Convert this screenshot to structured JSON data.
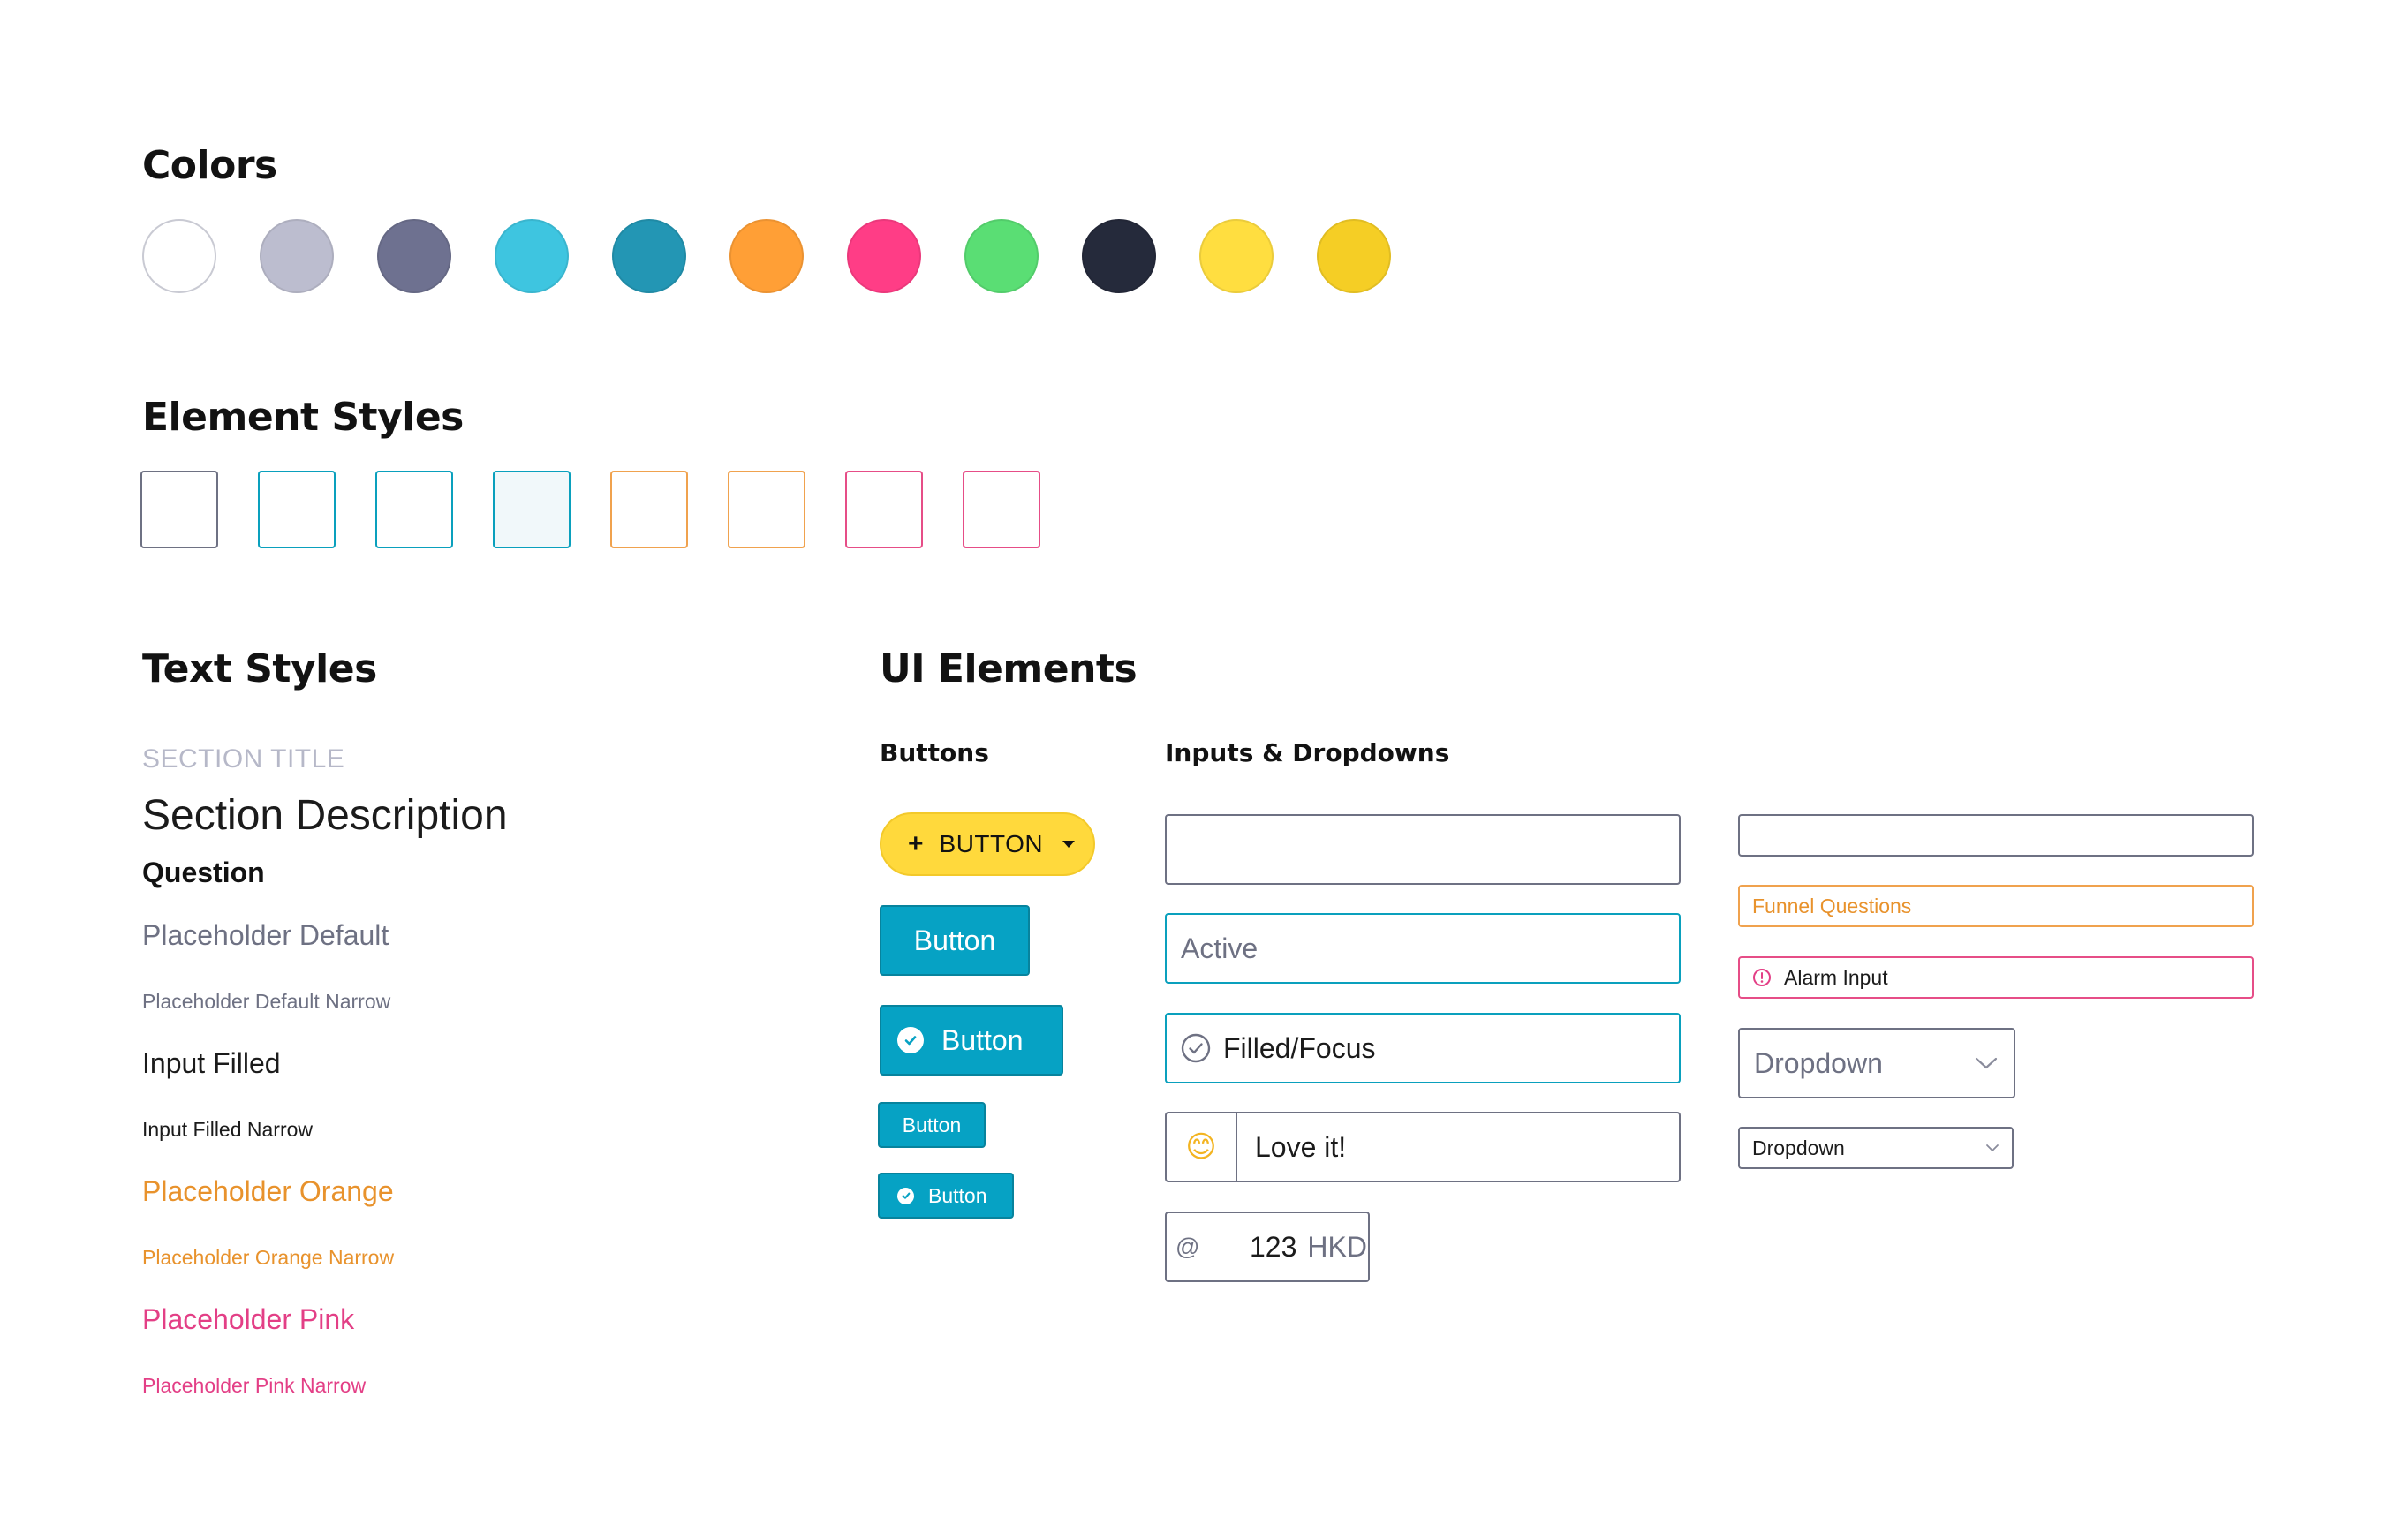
{
  "sections": {
    "colors_title": "Colors",
    "element_styles_title": "Element Styles",
    "text_styles_title": "Text Styles",
    "ui_elements_title": "UI Elements",
    "buttons_title": "Buttons",
    "inputs_title": "Inputs & Dropdowns"
  },
  "palette": [
    "#ffffff",
    "#bcbdcf",
    "#6e7190",
    "#3ec5e0",
    "#2396b4",
    "#ff9f36",
    "#ff3d86",
    "#5ade74",
    "#252a3b",
    "#ffde40",
    "#f5ce25"
  ],
  "element_styles": [
    {
      "border": "#6e7183",
      "fill": "#ffffff"
    },
    {
      "border": "#0aa0bd",
      "fill": "#ffffff"
    },
    {
      "border": "#0aa0bd",
      "fill": "#ffffff"
    },
    {
      "border": "#0aa0bd",
      "fill": "#f1f8fa"
    },
    {
      "border": "#f0a24e",
      "fill": "#ffffff"
    },
    {
      "border": "#f0a24e",
      "fill": "#ffffff"
    },
    {
      "border": "#e64d87",
      "fill": "#ffffff"
    },
    {
      "border": "#e64d87",
      "fill": "#ffffff"
    }
  ],
  "text_styles": {
    "section_title": "SECTION TITLE",
    "section_description": "Section Description",
    "question": "Question",
    "placeholder_default": "Placeholder Default",
    "placeholder_default_narrow": "Placeholder Default Narrow",
    "input_filled": "Input Filled",
    "input_filled_narrow": "Input Filled Narrow",
    "placeholder_orange": "Placeholder Orange",
    "placeholder_orange_narrow": "Placeholder Orange Narrow",
    "placeholder_pink": "Placeholder Pink",
    "placeholder_pink_narrow": "Placeholder Pink Narrow"
  },
  "buttons": {
    "yellow_label": "BUTTON",
    "large_label": "Button",
    "large_check_label": "Button",
    "small_label": "Button",
    "small_check_label": "Button"
  },
  "inputs": {
    "empty_value": "",
    "active_placeholder": "Active",
    "filled_focus_value": "Filled/Focus",
    "emoji": "😊",
    "emoji_value": "Love it!",
    "at_symbol": "@",
    "amount_value": "123",
    "amount_unit": "HKD",
    "narrow_empty_value": "",
    "funnel_placeholder": "Funnel Questions",
    "alarm_value": "Alarm Input",
    "dropdown_large_value": "Dropdown",
    "dropdown_small_value": "Dropdown"
  },
  "theme": {
    "teal": "#06a2c4",
    "orange": "#e8922c",
    "pink": "#e33f86",
    "gray_text": "#6e7183",
    "light_gray_text": "#b6b8c8",
    "dark_text": "#121212"
  }
}
